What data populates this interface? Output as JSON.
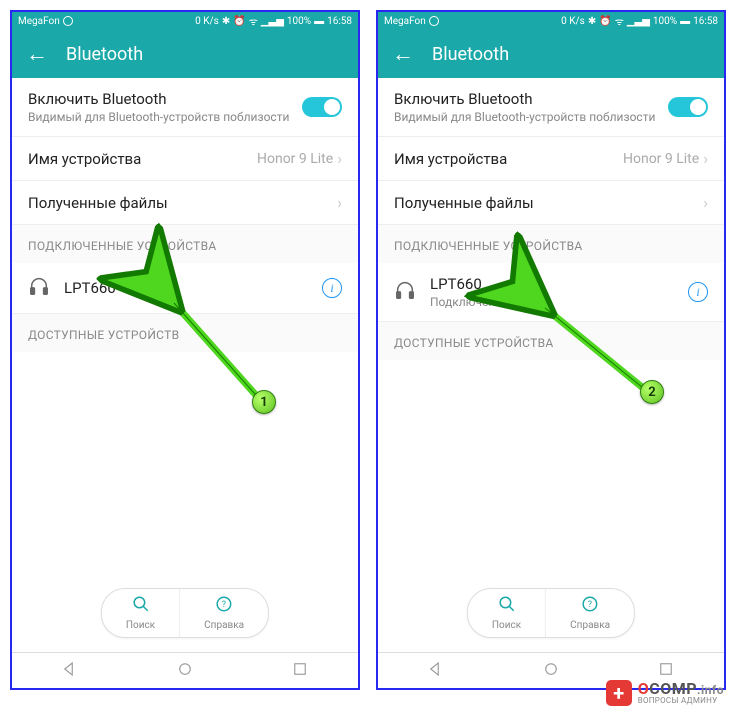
{
  "status": {
    "carrier": "MegaFon",
    "speed": "0 K/s",
    "battery": "100%",
    "time": "16:58"
  },
  "appbar": {
    "title": "Bluetooth"
  },
  "enable": {
    "label": "Включить Bluetooth",
    "sub": "Видимый для Bluetooth-устройств поблизости"
  },
  "deviceName": {
    "label": "Имя устройства",
    "value": "Honor 9 Lite"
  },
  "receivedFiles": {
    "label": "Полученные файлы"
  },
  "sections": {
    "connected": "ПОДКЛЮЧЕННЫЕ УСТРОЙСТВА",
    "available": "ДОСТУПНЫЕ УСТРОЙСТВА",
    "availableTrunc": "ДОСТУПНЫЕ УСТРОЙСТВ"
  },
  "device": {
    "name": "LPT660",
    "status": "Подключено"
  },
  "actions": {
    "search": "Поиск",
    "help": "Справка"
  },
  "badges": {
    "one": "1",
    "two": "2"
  },
  "watermark": {
    "brand_o": "O",
    "brand_rest": "COMP",
    "brand_suffix": ".info",
    "tag": "ВОПРОСЫ АДМИНУ"
  }
}
